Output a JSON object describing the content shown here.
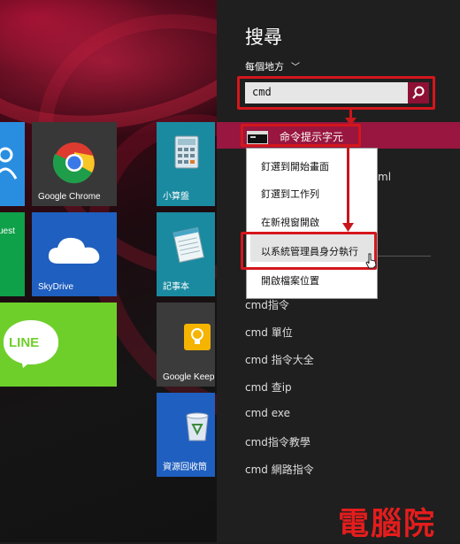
{
  "start": {
    "tiles": [
      {
        "id": "google-chrome",
        "label": "Google Chrome"
      },
      {
        "id": "skydrive",
        "label": "SkyDrive"
      },
      {
        "id": "line",
        "label": "LINE"
      },
      {
        "id": "calculator",
        "label": "小算盤"
      },
      {
        "id": "notepad",
        "label": "記事本"
      },
      {
        "id": "google-keep",
        "label": "Google Keep"
      },
      {
        "id": "recycle-bin",
        "label": "資源回收筒"
      },
      {
        "id": "partial-tile",
        "label": "uest"
      }
    ]
  },
  "search": {
    "title": "搜尋",
    "scope_label": "每個地方",
    "query": "cmd"
  },
  "results": {
    "selected": "命令提示字元",
    "partial_ml": "ml",
    "items": [
      "cmd指令",
      "cmd 單位",
      "cmd 指令大全",
      "cmd 查ip",
      "cmd exe",
      "cmd指令教學",
      "cmd 網路指令"
    ]
  },
  "context_menu": {
    "items": [
      "釘選到開始畫面",
      "釘選到工作列",
      "在新視窗開啟",
      "以系統管理員身分執行",
      "開啟檔案位置"
    ]
  },
  "watermark": "電腦院",
  "colors": {
    "accent": "#98163f",
    "search_button": "#8e1034",
    "highlight_box": "#d4161c",
    "line_tile": "#6fcf2a",
    "skydrive_tile": "#1f5fbf",
    "teal_tile": "#1a8aa0"
  }
}
